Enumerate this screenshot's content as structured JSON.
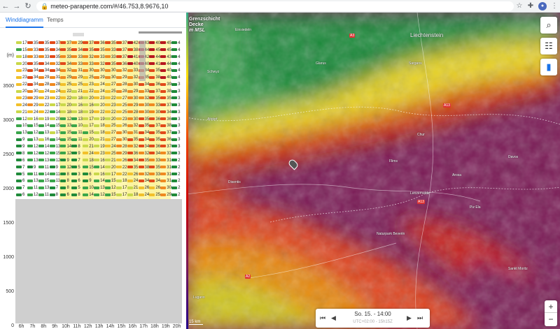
{
  "browser": {
    "url": "meteo-parapente.com/#/46.753,8.9676,10"
  },
  "tabs": [
    "Winddiagramm",
    "Temps"
  ],
  "chart": {
    "unit": "(m)",
    "y_ticks": [
      "3500",
      "3000",
      "2500",
      "2000",
      "1500",
      "1000",
      "500",
      "0"
    ],
    "hours": [
      "6h",
      "7h",
      "8h",
      "9h",
      "10h",
      "11h",
      "12h",
      "13h",
      "14h",
      "15h",
      "16h",
      "17h",
      "18h",
      "19h",
      "20h"
    ],
    "row_values": [
      [
        "17",
        "35",
        "35",
        "37",
        "37",
        "29",
        "37",
        "36",
        "35",
        "37",
        "42",
        "43",
        "40",
        "45",
        "4"
      ],
      [
        "15",
        "33",
        "35",
        "34",
        "35",
        "34",
        "35",
        "35",
        "33",
        "37",
        "38",
        "44",
        "45",
        "45",
        "4"
      ],
      [
        "18",
        "33",
        "33",
        "35",
        "33",
        "33",
        "32",
        "33",
        "33",
        "37",
        "41",
        "42",
        "44",
        "43",
        "4"
      ],
      [
        "20",
        "35",
        "34",
        "32",
        "34",
        "33",
        "33",
        "32",
        "35",
        "36",
        "40",
        "40",
        "41",
        "44",
        "4"
      ],
      [
        "23",
        "34",
        "34",
        "34",
        "32",
        "31",
        "30",
        "30",
        "30",
        "32",
        "33",
        "34",
        "35",
        "40",
        "4"
      ],
      [
        "23",
        "34",
        "29",
        "31",
        "29",
        "29",
        "25",
        "29",
        "30",
        "29",
        "32",
        "35",
        "38",
        "40",
        "4"
      ],
      [
        "22",
        "34",
        "28",
        "28",
        "25",
        "25",
        "23",
        "24",
        "27",
        "28",
        "30",
        "34",
        "36",
        "39",
        "3"
      ],
      [
        "20",
        "30",
        "24",
        "24",
        "22",
        "21",
        "22",
        "24",
        "25",
        "28",
        "29",
        "33",
        "37",
        "38",
        "3"
      ],
      [
        "23",
        "29",
        "23",
        "22",
        "22",
        "18",
        "20",
        "23",
        "22",
        "27",
        "30",
        "32",
        "35",
        "35",
        "3"
      ],
      [
        "24",
        "29",
        "22",
        "17",
        "20",
        "16",
        "16",
        "20",
        "23",
        "25",
        "29",
        "30",
        "33",
        "37",
        "3"
      ],
      [
        "21",
        "24",
        "22",
        "14",
        "18",
        "18",
        "19",
        "22",
        "22",
        "25",
        "28",
        "30",
        "30",
        "34",
        "3"
      ],
      [
        "12",
        "16",
        "19",
        "20",
        "12",
        "13",
        "17",
        "19",
        "20",
        "23",
        "30",
        "35",
        "36",
        "36",
        "3"
      ],
      [
        "10",
        "15",
        "14",
        "15",
        "13",
        "10",
        "17",
        "18",
        "25",
        "26",
        "32",
        "35",
        "37",
        "38",
        "3"
      ],
      [
        "13",
        "12",
        "13",
        "17",
        "15",
        "11",
        "15",
        "18",
        "27",
        "30",
        "31",
        "34",
        "35",
        "37",
        "3"
      ],
      [
        "9",
        "13",
        "16",
        "14",
        "15",
        "11",
        "20",
        "21",
        "27",
        "30",
        "35",
        "34",
        "35",
        "36",
        "3"
      ],
      [
        "9",
        "12",
        "14",
        "13",
        "14",
        "8",
        "21",
        "19",
        "24",
        "28",
        "32",
        "34",
        "36",
        "37",
        "3"
      ],
      [
        "8",
        "12",
        "12",
        "15",
        "12",
        "9",
        "24",
        "23",
        "25",
        "29",
        "36",
        "32",
        "34",
        "33",
        "3"
      ],
      [
        "6",
        "13",
        "13",
        "12",
        "9",
        "7",
        "18",
        "16",
        "21",
        "26",
        "34",
        "35",
        "33",
        "31",
        "2"
      ],
      [
        "7",
        "9",
        "11",
        "9",
        "12",
        "5",
        "15",
        "14",
        "20",
        "22",
        "35",
        "38",
        "35",
        "31",
        "2"
      ],
      [
        "5",
        "11",
        "14",
        "11",
        "8",
        "3",
        "6",
        "16",
        "17",
        "22",
        "26",
        "32",
        "33",
        "31",
        "2"
      ],
      [
        "6",
        "13",
        "15",
        "11",
        "8",
        "6",
        "9",
        "14",
        "15",
        "18",
        "24",
        "34",
        "34",
        "31",
        "2"
      ],
      [
        "7",
        "11",
        "13",
        "7",
        "8",
        "5",
        "10",
        "13",
        "12",
        "17",
        "21",
        "26",
        "26",
        "30",
        "2"
      ],
      [
        "6",
        "12",
        "11",
        "8",
        "6",
        "8",
        "14",
        "12",
        "15",
        "17",
        "18",
        "24",
        "25",
        "29",
        "2"
      ]
    ]
  },
  "map": {
    "title_line1": "Grenzschicht",
    "title_line2": "Decke",
    "title_line3": "m MSL",
    "labels": [
      "Einsiedeln",
      "Liechtenstein",
      "Schwyz",
      "Glarus",
      "Sargans",
      "Altdorf",
      "Chur",
      "Davos",
      "Disentis",
      "Flims",
      "Arosa",
      "Lenzerheide",
      "Piz Ela",
      "Naturpark Beverin",
      "Sankt Moritz",
      "Lugano"
    ],
    "roads": [
      "A3",
      "A13",
      "A13",
      "A2"
    ],
    "time_label": "So. 15. - 14:00",
    "time_sub": "UTC+02:00 - 15h15Z",
    "scale": "15 km",
    "buttons": {
      "search": "⌕",
      "settings": "☷",
      "chart": "▮",
      "zoom_in": "+",
      "zoom_out": "−"
    },
    "colors": {
      "low": "#33aa55",
      "mid": "#f5d000",
      "high": "#e03a00",
      "top": "#7a1a55"
    }
  }
}
